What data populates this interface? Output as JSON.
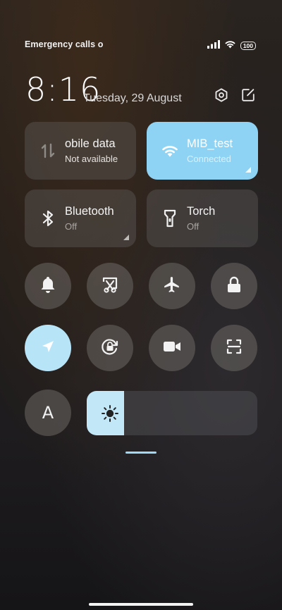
{
  "status_bar": {
    "carrier_text": "Emergency calls o",
    "battery_level": "100",
    "icons": [
      "signal-icon",
      "wifi-icon",
      "battery-icon"
    ]
  },
  "header": {
    "time": "8:16",
    "date": "Tuesday, 29 August",
    "icons": [
      "settings-icon",
      "edit-icon"
    ]
  },
  "tiles": {
    "mobile_data": {
      "title": "obile data",
      "subtitle": "Not available",
      "active": false
    },
    "wifi": {
      "title": "MIB_test",
      "subtitle": "Connected",
      "active": true
    },
    "bluetooth": {
      "title": "Bluetooth",
      "subtitle": "Off",
      "active": false
    },
    "torch": {
      "title": "Torch",
      "subtitle": "Off",
      "active": false
    }
  },
  "toggles_row1": [
    "bell-icon",
    "screenshot-icon",
    "airplane-icon",
    "lock-icon"
  ],
  "toggles_row2": [
    "location-icon",
    "rotation-lock-icon",
    "video-camera-icon",
    "scanner-icon"
  ],
  "reading_mode_label": "A",
  "brightness": {
    "level": 0.22,
    "icon": "sun-icon"
  },
  "colors": {
    "accent_active": "#8fd3f4",
    "toggle_active": "#b8e4f8",
    "tile_inactive": "#5f5c5a"
  }
}
